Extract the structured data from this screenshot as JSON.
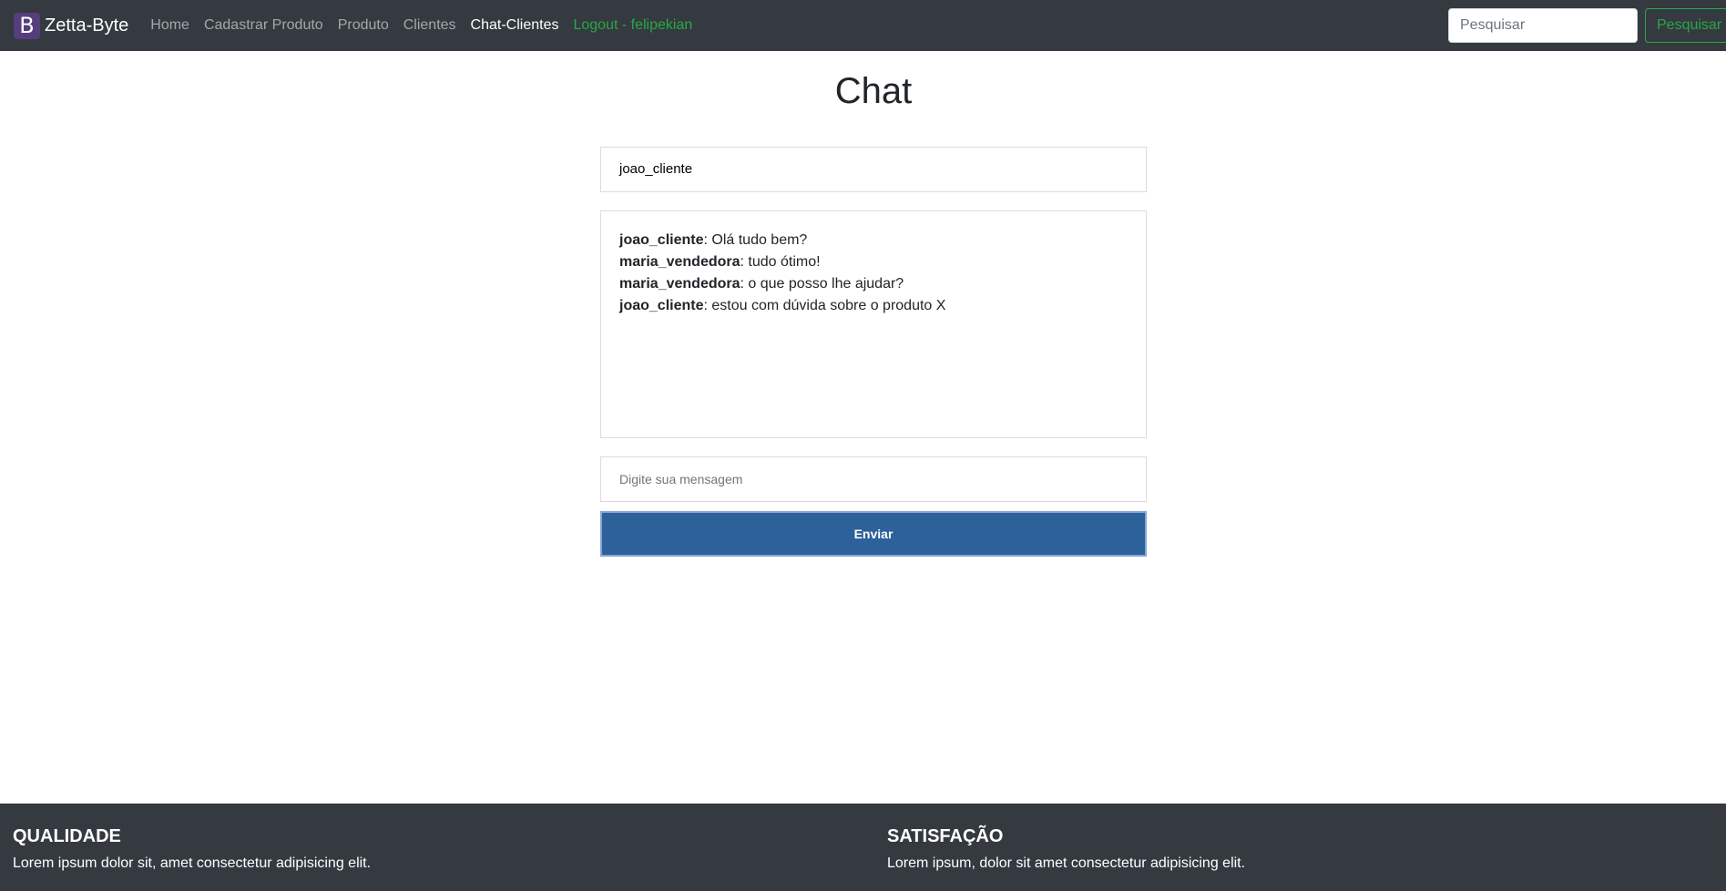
{
  "navbar": {
    "brand_logo": "B",
    "brand_name": "Zetta-Byte",
    "links": [
      {
        "label": "Home"
      },
      {
        "label": "Cadastrar Produto"
      },
      {
        "label": "Produto"
      },
      {
        "label": "Clientes"
      },
      {
        "label": "Chat-Clientes"
      },
      {
        "label": "Logout - felipekian"
      }
    ],
    "search_placeholder": "Pesquisar",
    "search_button": "Pesquisar"
  },
  "chat": {
    "title": "Chat",
    "user_value": "joao_cliente",
    "messages": [
      {
        "author": "joao_cliente",
        "text": ": Olá tudo bem?"
      },
      {
        "author": "maria_vendedora",
        "text": ": tudo ótimo!"
      },
      {
        "author": "maria_vendedora",
        "text": ": o que posso lhe ajudar?"
      },
      {
        "author": "joao_cliente",
        "text": ": estou com dúvida sobre o produto X"
      }
    ],
    "message_placeholder": "Digite sua mensagem",
    "send_label": "Enviar"
  },
  "footer": {
    "columns": [
      {
        "title": "QUALIDADE",
        "text": "Lorem ipsum dolor sit, amet consectetur adipisicing elit."
      },
      {
        "title": "SATISFAÇÃO",
        "text": "Lorem ipsum, dolor sit amet consectetur adipisicing elit."
      }
    ]
  },
  "colors": {
    "navbar_bg": "#343a40",
    "brand_logo_bg": "#563d7c",
    "success": "#28a745",
    "send_button_bg": "#2c6199"
  }
}
